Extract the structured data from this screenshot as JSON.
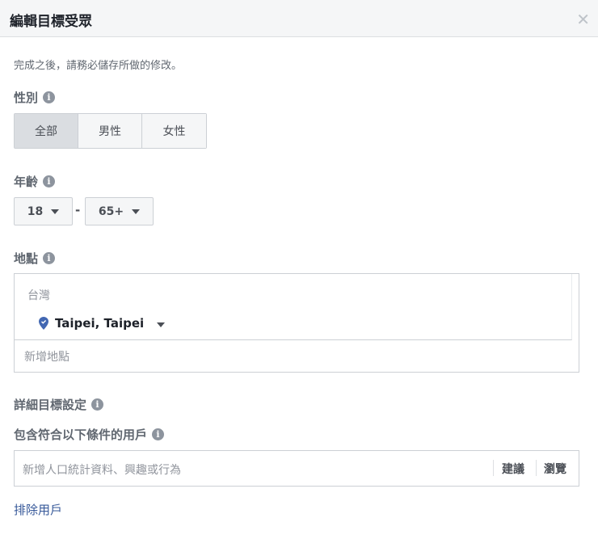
{
  "header": {
    "title": "編輯目標受眾",
    "close_icon": "close-icon"
  },
  "note": "完成之後，請務必儲存所做的修改。",
  "gender": {
    "label": "性別",
    "options": [
      "全部",
      "男性",
      "女性"
    ],
    "selected": "全部"
  },
  "age": {
    "label": "年齡",
    "min": "18",
    "separator": "-",
    "max": "65+"
  },
  "location": {
    "label": "地點",
    "country": "台灣",
    "city": "Taipei, Taipei",
    "add_placeholder": "新增地點"
  },
  "detailed": {
    "label": "詳細目標設定",
    "include_label": "包含符合以下條件的用戶",
    "placeholder": "新增人口統計資料、興趣或行為",
    "suggest": "建議",
    "browse": "瀏覽",
    "exclude_link": "排除用戶"
  },
  "colors": {
    "link": "#365899",
    "pin": "#4267b2"
  }
}
